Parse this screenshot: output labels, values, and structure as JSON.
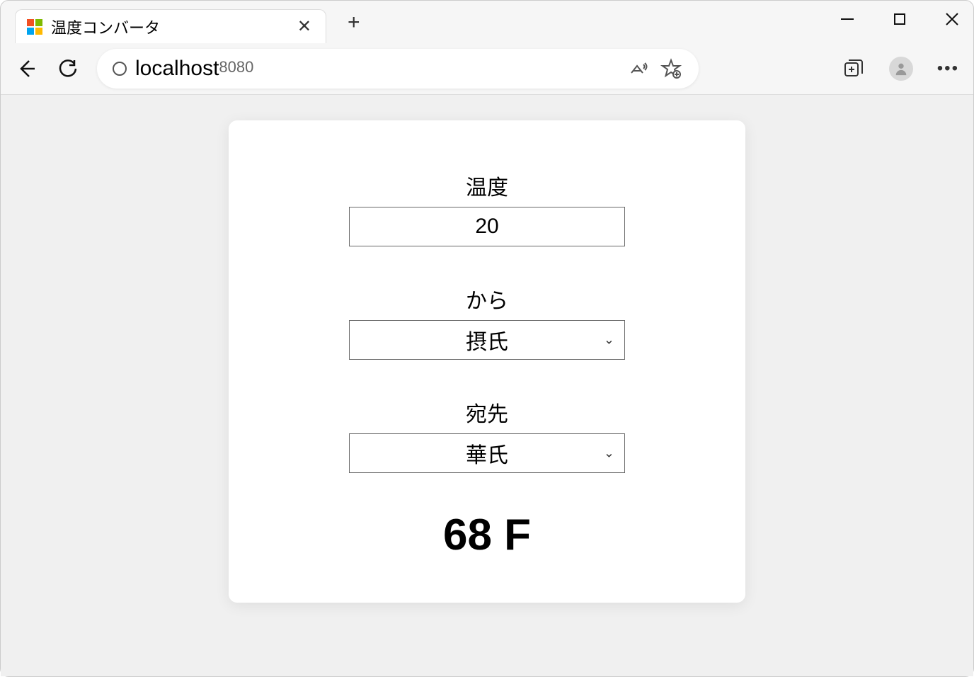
{
  "tab": {
    "title": "温度コンバータ"
  },
  "address": {
    "host": "localhost",
    "port": "8080"
  },
  "app": {
    "labels": {
      "temperature": "温度",
      "from": "から",
      "to": "宛先"
    },
    "values": {
      "temperature": "20",
      "from": "摂氏",
      "to": "華氏"
    },
    "result": "68 F"
  }
}
